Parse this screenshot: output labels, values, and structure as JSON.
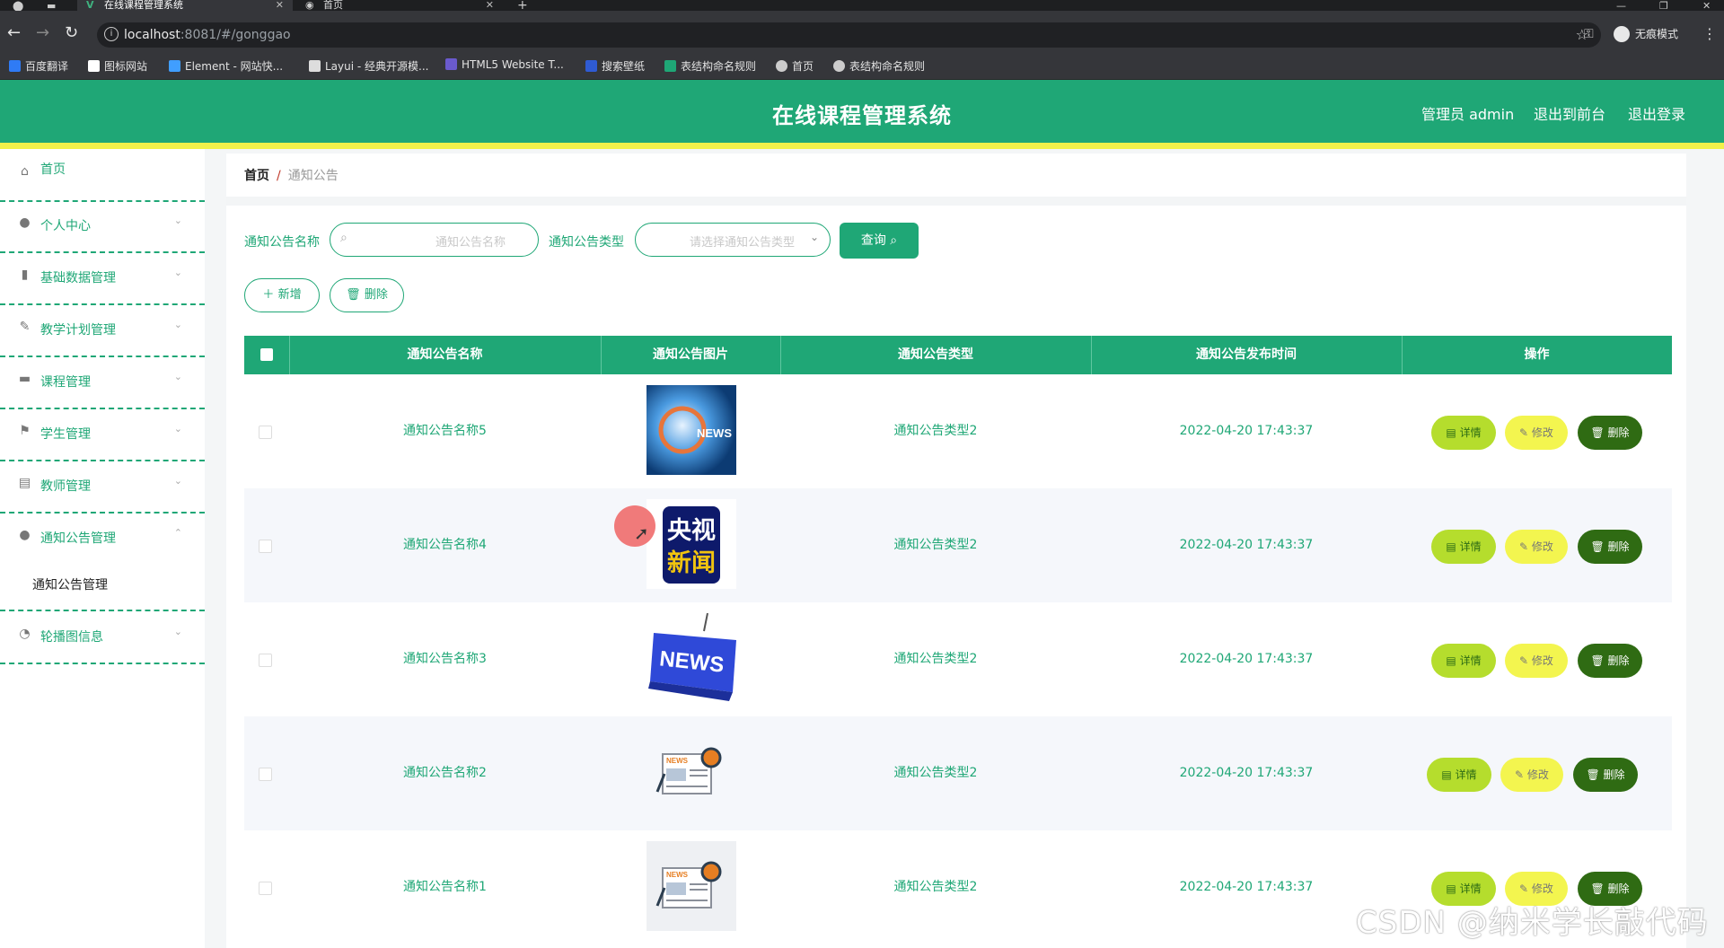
{
  "browser": {
    "tabs": [
      {
        "label": "在线课程管理系统",
        "active": true
      },
      {
        "label": "首页",
        "active": false
      }
    ],
    "url_host": "localhost",
    "url_rest": ":8081/#/gonggao",
    "incognito_label": "无痕模式",
    "bookmarks": [
      {
        "label": "百度翻译",
        "color": "#2f7bf5"
      },
      {
        "label": "图标网站",
        "color": "#ffffff"
      },
      {
        "label": "Element - 网站快...",
        "color": "#409eff"
      },
      {
        "label": "Layui - 经典开源模...",
        "color": "#ffffff"
      },
      {
        "label": "HTML5 Website T...",
        "color": "#6a5acd"
      },
      {
        "label": "搜索壁纸",
        "color": "#2f5bd3"
      },
      {
        "label": "表结构命名规则",
        "color": "#1fa776"
      },
      {
        "label": "首页",
        "color": "#cccccc"
      },
      {
        "label": "表结构命名规则",
        "color": "#cccccc"
      }
    ]
  },
  "header": {
    "title": "在线课程管理系统",
    "admin": "管理员 admin",
    "front": "退出到前台",
    "logout": "退出登录",
    "color": "#1fa776",
    "accent": "#f1f14a"
  },
  "sidebar": {
    "items": [
      {
        "label": "首页",
        "icon": "home-icon"
      },
      {
        "label": "个人中心",
        "icon": "user-icon"
      },
      {
        "label": "基础数据管理",
        "icon": "bar-chart-icon"
      },
      {
        "label": "教学计划管理",
        "icon": "edit-icon"
      },
      {
        "label": "课程管理",
        "icon": "briefcase-icon"
      },
      {
        "label": "学生管理",
        "icon": "flag-icon"
      },
      {
        "label": "教师管理",
        "icon": "clipboard-icon"
      },
      {
        "label": "通知公告管理",
        "icon": "user-icon"
      },
      {
        "label": "轮播图信息",
        "icon": "speed-icon"
      }
    ],
    "sub_item": "通知公告管理"
  },
  "breadcrumb": {
    "home": "首页",
    "sep": "/",
    "current": "通知公告"
  },
  "search": {
    "name_label": "通知公告名称",
    "name_placeholder": "通知公告名称",
    "type_label": "通知公告类型",
    "type_placeholder": "请选择通知公告类型",
    "query_button": "查询"
  },
  "actions": {
    "add": "新增",
    "delete": "删除"
  },
  "table": {
    "headers": [
      "通知公告名称",
      "通知公告图片",
      "通知公告类型",
      "通知公告发布时间",
      "操作"
    ],
    "rows": [
      {
        "name": "通知公告名称5",
        "image": "news-globe-image",
        "type": "通知公告类型2",
        "time": "2022-04-20 17:43:37"
      },
      {
        "name": "通知公告名称4",
        "image": "cctv-news-logo",
        "type": "通知公告类型2",
        "time": "2022-04-20 17:43:37"
      },
      {
        "name": "通知公告名称3",
        "image": "news-key-image",
        "type": "通知公告类型2",
        "time": "2022-04-20 17:43:37"
      },
      {
        "name": "通知公告名称2",
        "image": "newspaper-icon-image",
        "type": "通知公告类型2",
        "time": "2022-04-20 17:43:37"
      },
      {
        "name": "通知公告名称1",
        "image": "newspaper-icon-image",
        "type": "通知公告类型2",
        "time": "2022-04-20 17:43:37"
      }
    ],
    "row_actions": {
      "detail": "详情",
      "edit": "修改",
      "delete": "删除"
    }
  },
  "cctv_logo_text": "央视新闻",
  "news_text": "NEWS",
  "watermark": "CSDN @纳米学长敲代码"
}
